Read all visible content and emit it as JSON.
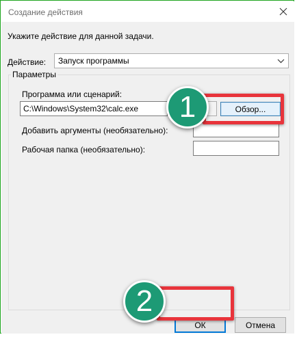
{
  "window": {
    "title": "Создание действия",
    "instruction": "Укажите действие для данной задачи."
  },
  "action": {
    "label": "Действие:",
    "selected": "Запуск программы"
  },
  "params": {
    "group_label": "Параметры",
    "program_label": "Программа или сценарий:",
    "program_value": "C:\\Windows\\System32\\calc.exe",
    "browse_label": "Обзор...",
    "args_label": "Добавить аргументы (необязательно):",
    "args_value": "",
    "workdir_label": "Рабочая папка (необязательно):",
    "workdir_value": ""
  },
  "buttons": {
    "ok": "ОК",
    "cancel": "Отмена"
  },
  "annotations": {
    "step1": "1",
    "step2": "2"
  },
  "colors": {
    "marker": "#1d9a75",
    "highlight": "#e8343b",
    "window_border": "#1ea51e",
    "focus_blue": "#0078d7"
  }
}
